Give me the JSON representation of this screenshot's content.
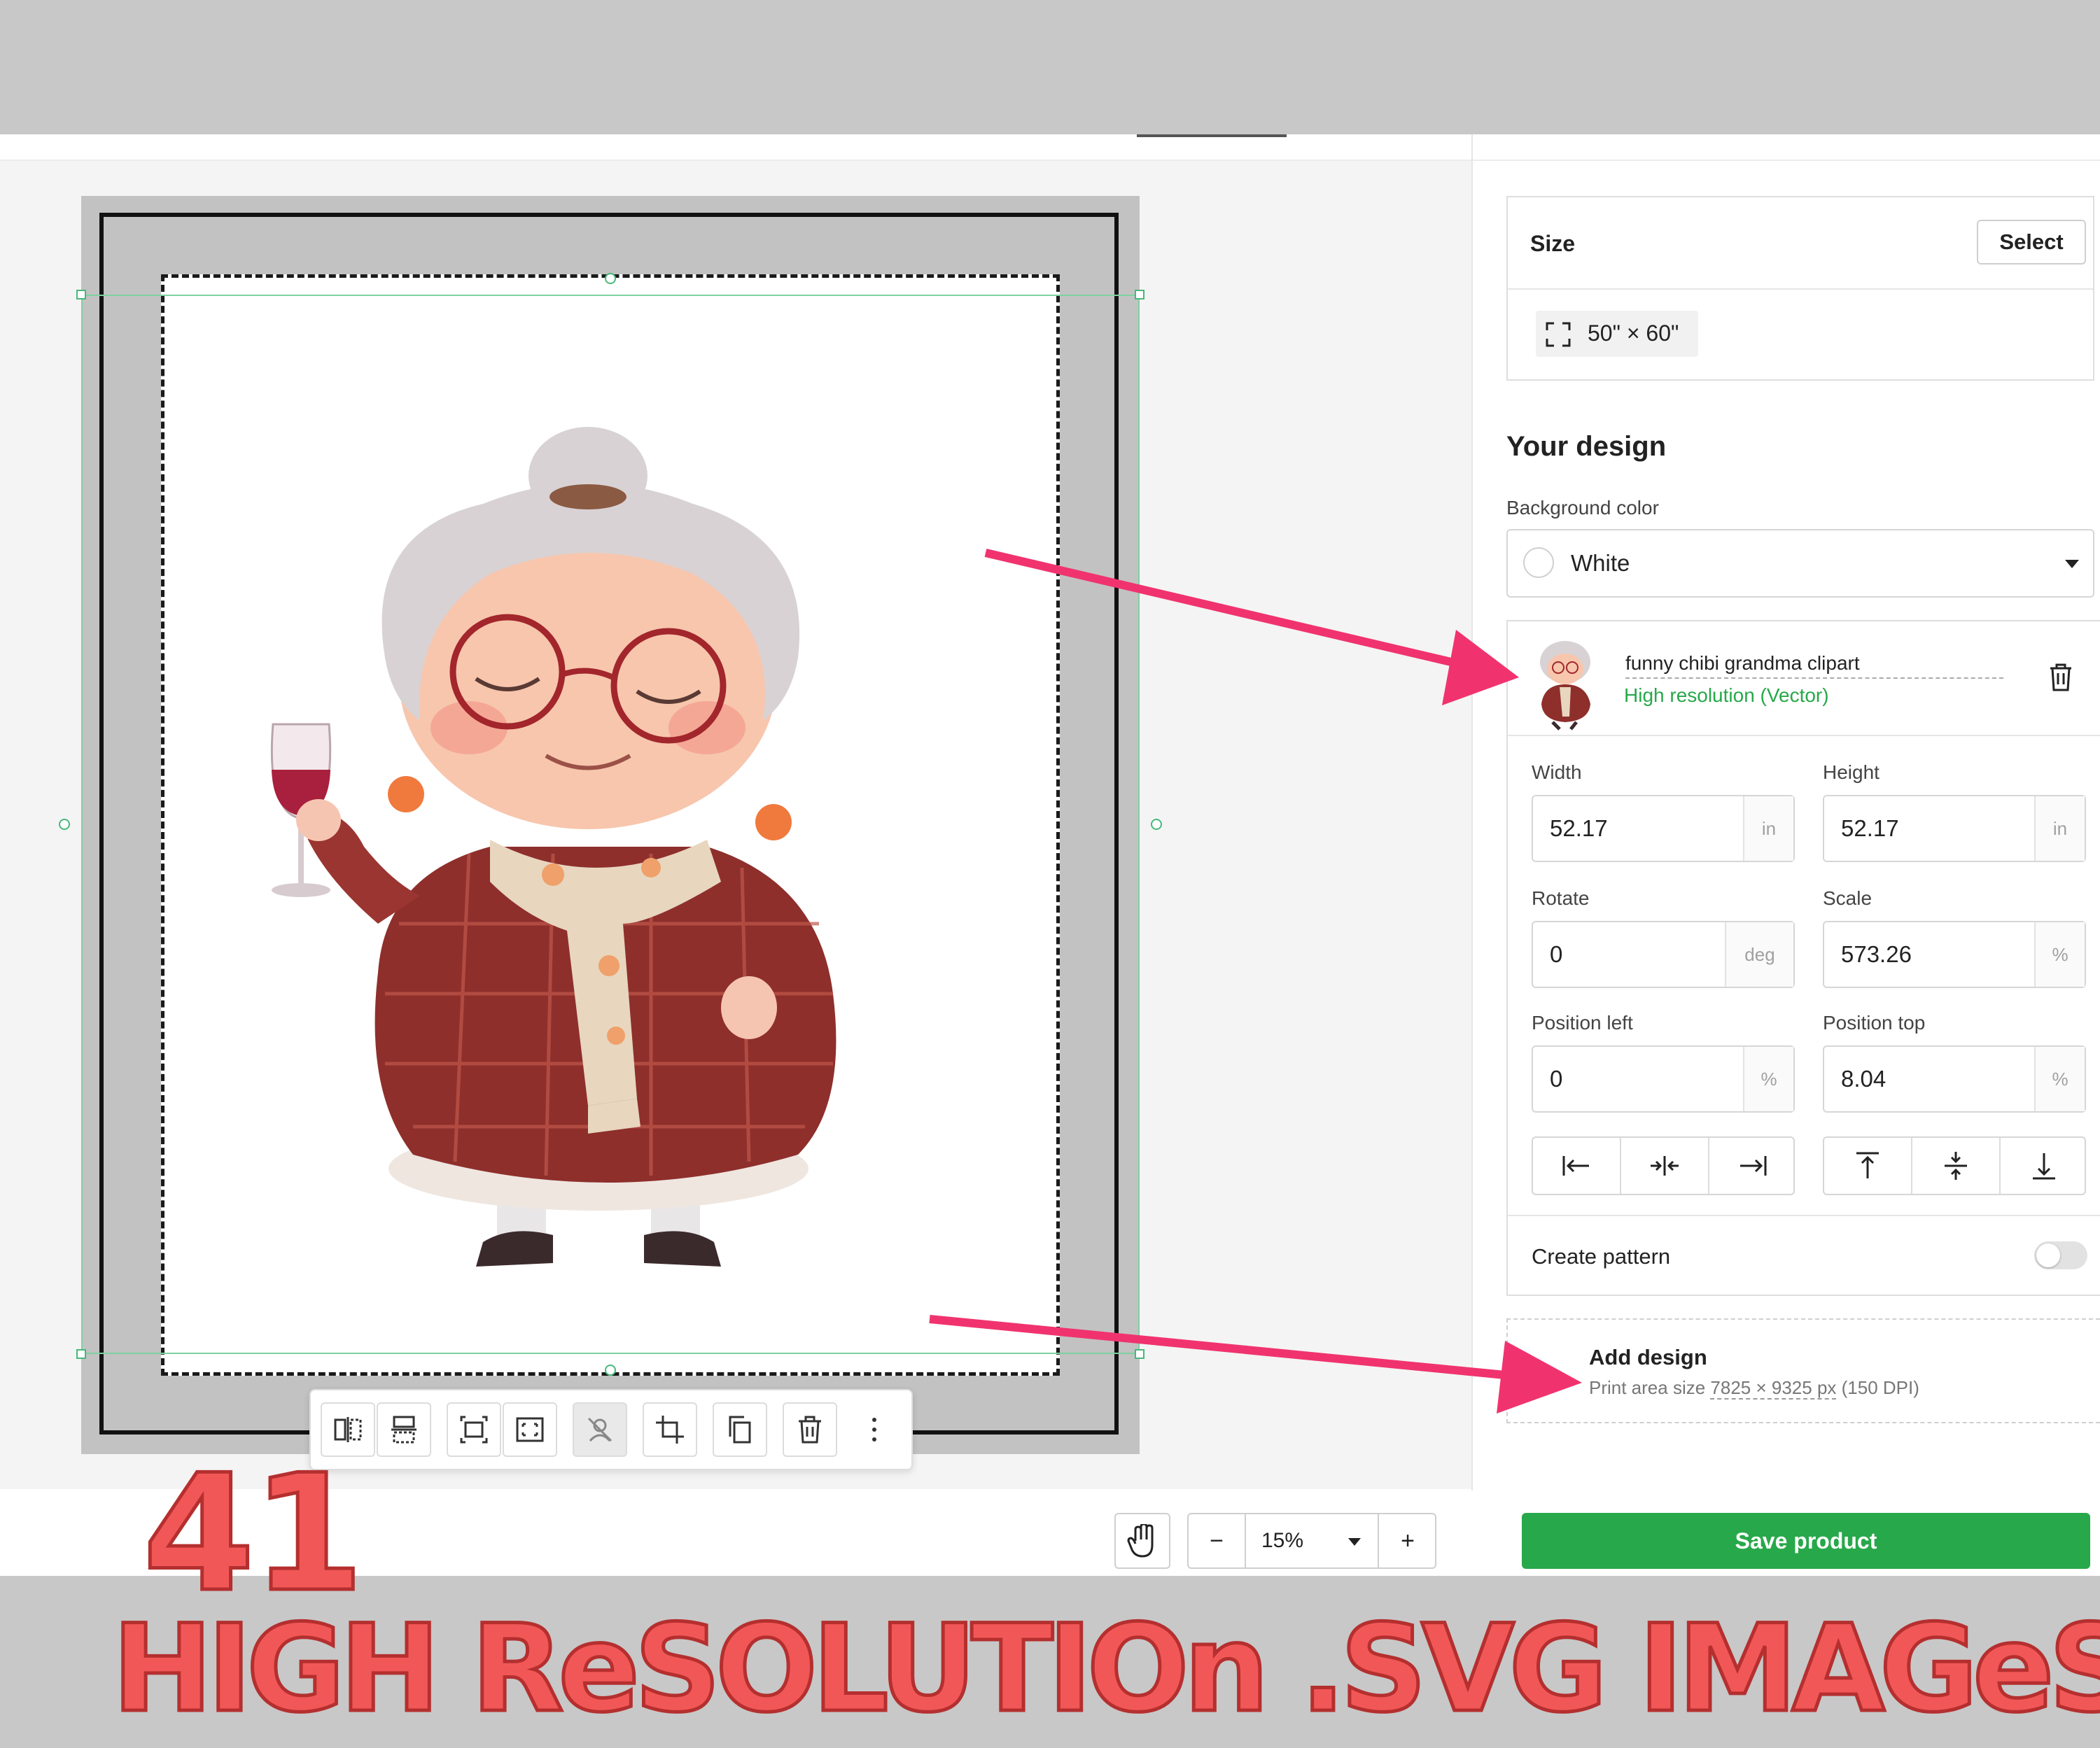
{
  "size_card": {
    "title": "Size",
    "select_label": "Select",
    "size_value": "50\" × 60\""
  },
  "design": {
    "section_title": "Your design",
    "background_label": "Background color",
    "background_value": "White",
    "layer": {
      "name": "funny chibi grandma clipart",
      "resolution": "High resolution (Vector)"
    },
    "fields": {
      "width_label": "Width",
      "width_value": "52.17",
      "width_unit": "in",
      "height_label": "Height",
      "height_value": "52.17",
      "height_unit": "in",
      "rotate_label": "Rotate",
      "rotate_value": "0",
      "rotate_unit": "deg",
      "scale_label": "Scale",
      "scale_value": "573.26",
      "scale_unit": "%",
      "pos_left_label": "Position left",
      "pos_left_value": "0",
      "pos_left_unit": "%",
      "pos_top_label": "Position top",
      "pos_top_value": "8.04",
      "pos_top_unit": "%"
    },
    "pattern_label": "Create pattern",
    "pattern_enabled": false
  },
  "add_design": {
    "title": "Add design",
    "subtitle_prefix": "Print area size ",
    "dimensions": "7825 × 9325 px",
    "dpi": " (150 DPI)"
  },
  "zoom": {
    "minus": "−",
    "value": "15%",
    "plus": "+"
  },
  "save_label": "Save product",
  "overlay": {
    "count": "41",
    "headline": "HIGH ReSOLUTIOn .SVG IMAGeS"
  },
  "colors": {
    "accent_green": "#27a84a",
    "arrow_pink": "#f0336e",
    "overlay_red": "#f25757"
  },
  "icons": [
    "flip-horizontal-icon",
    "flip-vertical-icon",
    "fit-icon",
    "fill-icon",
    "remove-background-icon",
    "crop-icon",
    "duplicate-icon",
    "trash-icon",
    "more-icon",
    "hand-icon",
    "trash-icon",
    "align-left-icon",
    "align-center-h-icon",
    "align-right-icon",
    "align-top-icon",
    "align-middle-v-icon",
    "align-bottom-icon"
  ]
}
